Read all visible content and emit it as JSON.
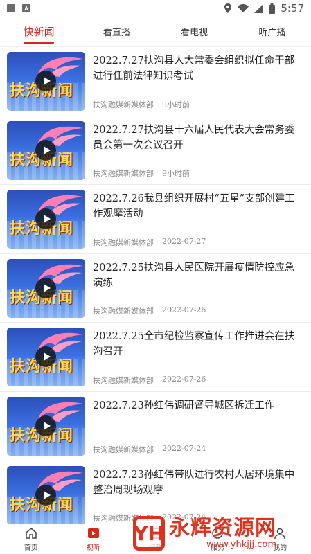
{
  "status_bar": {
    "time": "5:57",
    "left_icons": [
      "notification-square-icon",
      "a-badge-icon"
    ],
    "right_icons": [
      "location-icon",
      "wifi-icon",
      "signal-icon",
      "battery-icon"
    ]
  },
  "tabs": [
    {
      "label": "快新闻",
      "active": true
    },
    {
      "label": "看直播",
      "active": false
    },
    {
      "label": "看电视",
      "active": false
    },
    {
      "label": "听广播",
      "active": false
    }
  ],
  "thumbnail_text": "扶沟新闻",
  "news": [
    {
      "title": "2022.7.27扶沟县人大常委会组织拟任命干部进行任前法律知识考试",
      "source": "扶沟融媒新媒体部",
      "time": "9小时前"
    },
    {
      "title": "2022.7.27扶沟县十六届人民代表大会常务委员会第一次会议召开",
      "source": "扶沟融媒新媒体部",
      "time": "9小时前"
    },
    {
      "title": "2022.7.26我县组织开展村“五星”支部创建工作观摩活动",
      "source": "扶沟融媒新媒体部",
      "time": "2022-07-27"
    },
    {
      "title": "2022.7.25扶沟县人民医院开展疫情防控应急演练",
      "source": "扶沟融媒新媒体部",
      "time": "2022-07-26"
    },
    {
      "title": "2022.7.25全市纪检监察宣传工作推进会在扶沟召开",
      "source": "扶沟融媒新媒体部",
      "time": "2022-07-26"
    },
    {
      "title": "2022.7.23孙红伟调研督导城区拆迁工作",
      "source": "扶沟融媒新媒体部",
      "time": "2022-07-24"
    },
    {
      "title": "2022.7.23孙红伟带队进行农村人居环境集中整治周现场观摩",
      "source": "扶沟融媒新媒体部",
      "time": "2022-07-24"
    }
  ],
  "bottom_nav": [
    {
      "label": "首页",
      "icon": "home-icon",
      "active": false
    },
    {
      "label": "视听",
      "icon": "video-play-icon",
      "active": true
    },
    {
      "label": "问政",
      "icon": "question-icon",
      "active": false
    },
    {
      "label": "服务",
      "icon": "service-icon",
      "active": false
    },
    {
      "label": "我的",
      "icon": "user-icon",
      "active": false
    }
  ],
  "watermark": {
    "logo_char": "YH",
    "text": "永辉资源网",
    "url": "www.yhkjjj.com"
  },
  "colors": {
    "accent": "#d7261a",
    "watermark": "#e0301e"
  }
}
